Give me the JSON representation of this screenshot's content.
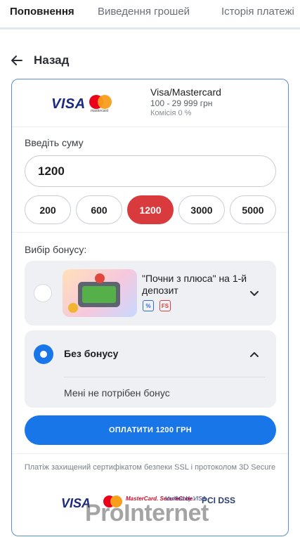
{
  "tabs": [
    {
      "label": "Поповнення",
      "active": true
    },
    {
      "label": "Виведення грошей",
      "active": false
    },
    {
      "label": "Історія платежі",
      "active": false
    }
  ],
  "back": {
    "label": "Назад",
    "icon": "arrow-left-icon"
  },
  "payment_method": {
    "logo_visa": "VISA",
    "logo_mastercard": "mastercard",
    "name": "Visa/Mastercard",
    "range": "100 - 29 999 грн",
    "fee": "Комісія 0 %"
  },
  "amount": {
    "label": "Введіть суму",
    "value": "1200",
    "presets": [
      "200",
      "600",
      "1200",
      "3000",
      "5000"
    ],
    "selected_preset": "1200"
  },
  "bonus": {
    "label": "Вибір бонусу:",
    "options": [
      {
        "title": "\"Почни з плюса\" на 1-й депозит",
        "selected": false,
        "expanded": false,
        "tags": [
          "%",
          "FS"
        ]
      },
      {
        "title": "Без бонусу",
        "selected": true,
        "expanded": true,
        "description": "Мені не потрібен бонус"
      }
    ]
  },
  "pay_button": {
    "label": "ОПЛАТИТИ 1200 ГРН"
  },
  "security_text": "Платіж захищений сертифікатом безпеки SSL і протоколом 3D Secure",
  "footer_logos": {
    "visa": "VISA",
    "mastercard_securecode": "MasterCard. SecureCode.",
    "verified_by_visa": "Verified by VISA",
    "pci_dss": "PCI DSS"
  },
  "watermark": "ProInternet",
  "colors": {
    "accent_blue": "#1976e8",
    "chip_active_red": "#d83a3e",
    "card_border": "#5b8ad9"
  }
}
